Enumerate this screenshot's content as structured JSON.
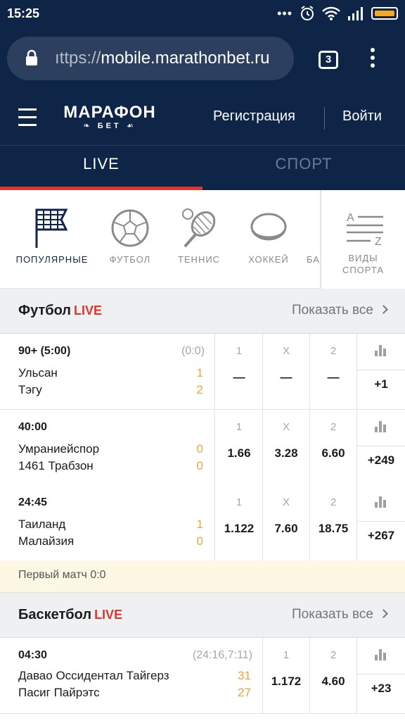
{
  "status_bar": {
    "time": "15:25",
    "icons": [
      "more-dots-icon",
      "alarm-icon",
      "wifi-icon",
      "signal-icon",
      "battery-icon"
    ]
  },
  "browser": {
    "url_prefix": "ıttps://",
    "url_host": "mobile.marathonbet.ru",
    "tab_count": "3"
  },
  "header": {
    "logo_top": "МАРАФОН",
    "logo_bottom": "БЕТ",
    "register": "Регистрация",
    "login": "Войти"
  },
  "tabs": {
    "live": "LIVE",
    "sport": "СПОРТ"
  },
  "categories": [
    {
      "label": "ПОПУЛЯРНЫЕ",
      "icon": "flag-icon"
    },
    {
      "label": "ФУТБОЛ",
      "icon": "soccer-ball-icon"
    },
    {
      "label": "ТЕННИС",
      "icon": "tennis-racket-icon"
    },
    {
      "label": "ХОККЕЙ",
      "icon": "hockey-puck-icon"
    },
    {
      "label": "БА",
      "icon": ""
    }
  ],
  "sport_kinds": {
    "label_line1": "ВИДЫ",
    "label_line2": "СПОРТА",
    "icon": "sort-az-icon"
  },
  "colors": {
    "navy": "#0f2548",
    "accent_red": "#e0352b",
    "score_orange": "#f0a23b"
  },
  "football": {
    "title": "Футбол",
    "live": "LIVE",
    "show_all": "Показать все",
    "events": [
      {
        "time": "90+ (5:00)",
        "extra": "(0:0)",
        "team1": "Ульсан",
        "score1": "1",
        "team2": "Тэгу",
        "score2": "2",
        "odds": [
          {
            "h": "1",
            "v": "—"
          },
          {
            "h": "X",
            "v": "—"
          },
          {
            "h": "2",
            "v": "—"
          }
        ],
        "more": "+1"
      },
      {
        "time": "40:00",
        "extra": "",
        "team1": "Умраниейспор",
        "score1": "0",
        "team2": "1461 Трабзон",
        "score2": "0",
        "odds": [
          {
            "h": "1",
            "v": "1.66"
          },
          {
            "h": "X",
            "v": "3.28"
          },
          {
            "h": "2",
            "v": "6.60"
          }
        ],
        "more": "+249"
      },
      {
        "time": "24:45",
        "extra": "",
        "team1": "Таиланд",
        "score1": "1",
        "team2": "Малайзия",
        "score2": "0",
        "odds": [
          {
            "h": "1",
            "v": "1.122"
          },
          {
            "h": "X",
            "v": "7.60"
          },
          {
            "h": "2",
            "v": "18.75"
          }
        ],
        "more": "+267"
      }
    ],
    "note": "Первый матч 0:0"
  },
  "basketball": {
    "title": "Баскетбол",
    "live": "LIVE",
    "show_all": "Показать все",
    "events": [
      {
        "time": "04:30",
        "extra": "(24:16,7:11)",
        "team1": "Давао Оссидентал Тайгерз",
        "score1": "31",
        "team2": "Пасиг Пайрэтс",
        "score2": "27",
        "odds": [
          {
            "h": "1",
            "v": "1.172"
          },
          {
            "h": "2",
            "v": "4.60"
          }
        ],
        "more": "+23"
      }
    ]
  }
}
